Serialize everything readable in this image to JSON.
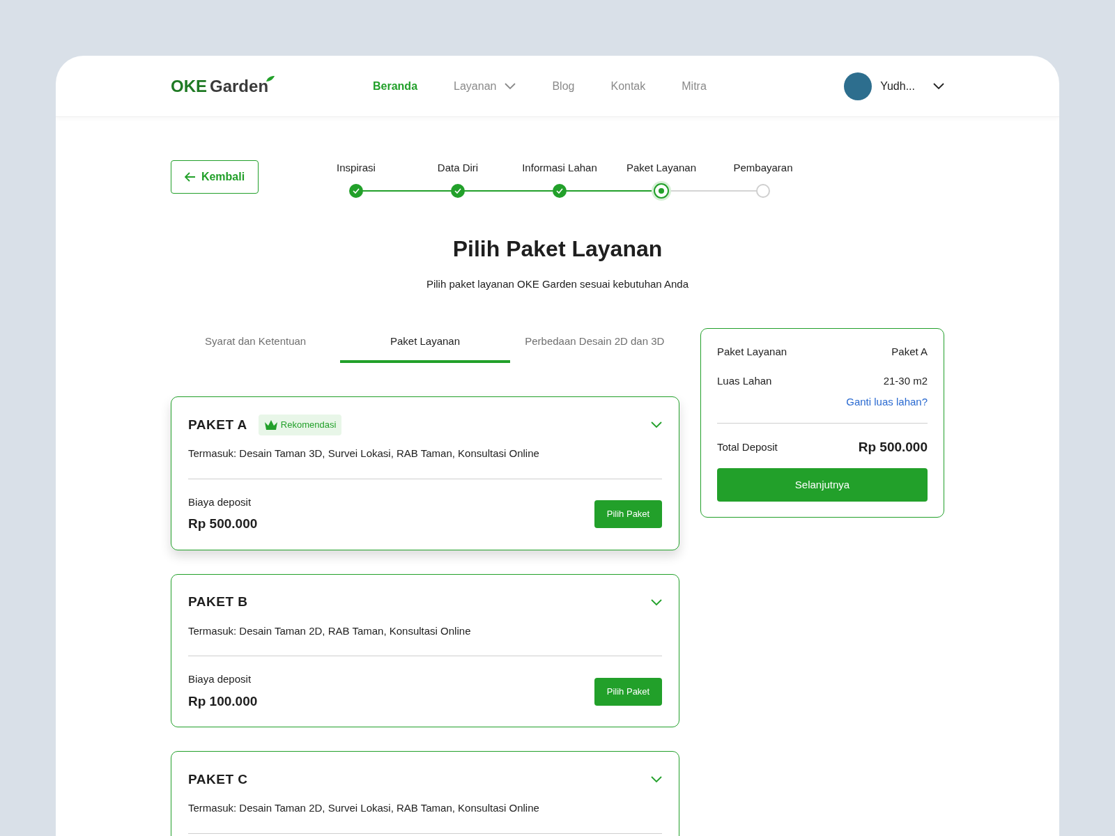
{
  "header": {
    "logo": {
      "part1": "OKE",
      "part2": "Garden"
    },
    "nav": [
      {
        "label": "Beranda",
        "selected": true,
        "dropdown": false
      },
      {
        "label": "Layanan",
        "selected": false,
        "dropdown": true
      },
      {
        "label": "Blog",
        "selected": false,
        "dropdown": false
      },
      {
        "label": "Kontak",
        "selected": false,
        "dropdown": false
      },
      {
        "label": "Mitra",
        "selected": false,
        "dropdown": false
      }
    ],
    "user": {
      "name": "Yudh..."
    }
  },
  "back_button": "Kembali",
  "stepper": [
    {
      "label": "Inspirasi",
      "done": true,
      "selected": false
    },
    {
      "label": "Data Diri",
      "done": true,
      "selected": false
    },
    {
      "label": "Informasi Lahan",
      "done": true,
      "selected": false
    },
    {
      "label": "Paket Layanan",
      "done": false,
      "selected": true
    },
    {
      "label": "Pembayaran",
      "done": false,
      "selected": false
    }
  ],
  "title": "Pilih Paket Layanan",
  "subtitle": "Pilih paket layanan OKE Garden sesuai kebutuhan Anda",
  "tabs": [
    {
      "label": "Syarat dan Ketentuan",
      "selected": false
    },
    {
      "label": "Paket Layanan",
      "selected": true
    },
    {
      "label": "Perbedaan Desain 2D dan 3D",
      "selected": false
    }
  ],
  "packages": [
    {
      "name": "PAKET A",
      "badge": "Rekomendasi",
      "selected": true,
      "includes": "Termasuk: Desain Taman 3D, Survei Lokasi, RAB Taman, Konsultasi Online",
      "price_label": "Biaya deposit",
      "price": "Rp 500.000",
      "button": "Pilih Paket"
    },
    {
      "name": "PAKET B",
      "selected": false,
      "includes": "Termasuk: Desain Taman 2D, RAB Taman, Konsultasi Online",
      "price_label": "Biaya deposit",
      "price": "Rp 100.000",
      "button": "Pilih Paket"
    },
    {
      "name": "PAKET C",
      "selected": false,
      "includes": "Termasuk: Desain Taman 2D, Survei Lokasi, RAB Taman, Konsultasi Online"
    }
  ],
  "summary": {
    "rows": [
      {
        "label": "Paket Layanan",
        "value": "Paket A"
      },
      {
        "label": "Luas Lahan",
        "value": "21-30 m2"
      }
    ],
    "change_link": "Ganti luas lahan?",
    "total_label": "Total Deposit",
    "total": "Rp 500.000",
    "button": "Selanjutnya"
  }
}
